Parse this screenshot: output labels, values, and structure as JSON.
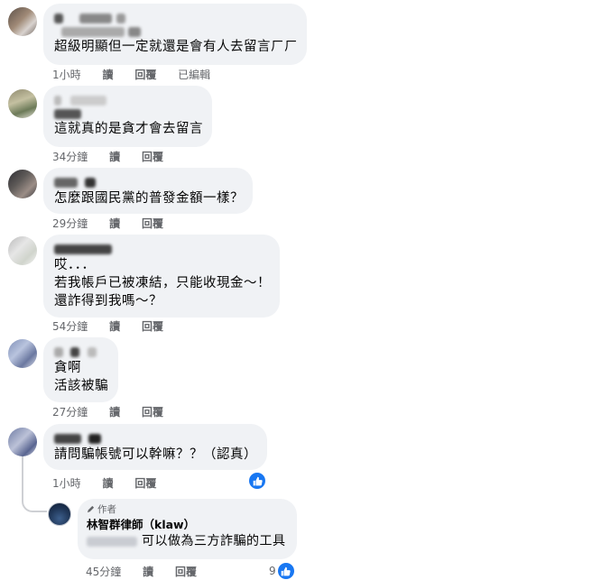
{
  "comments": [
    {
      "text": [
        "超級明顯但一定就還是會有人去留言ㄏㄏ"
      ],
      "time": "1小時",
      "reply": "讀",
      "reply2": "回覆",
      "edited": "已編輯"
    },
    {
      "text": [
        "這就真的是貪才會去留言"
      ],
      "time": "34分鐘",
      "reply": "讀",
      "reply2": "回覆"
    },
    {
      "text": [
        "怎麼跟國民黨的普發金額一樣？"
      ],
      "time": "29分鐘",
      "reply": "讀",
      "reply2": "回覆"
    },
    {
      "text": [
        "哎．．．",
        "若我帳戶已被凍結，只能收現金～！",
        "還詐得到我嗎～？"
      ],
      "time": "54分鐘",
      "reply": "讀",
      "reply2": "回覆"
    },
    {
      "text": [
        "貪啊",
        "活該被騙"
      ],
      "time": "27分鐘",
      "reply": "讀",
      "reply2": "回覆"
    },
    {
      "text": [
        "請問騙帳號可以幹嘛？？（認真）"
      ],
      "time": "1小時",
      "reply": "讀",
      "reply2": "回覆"
    }
  ],
  "author_reply": {
    "badge": "作者",
    "name": "林智群律師（klaw）",
    "text": "可以做為三方詐騙的工具",
    "time": "45分鐘",
    "reply": "讀",
    "reply2": "回覆",
    "likes": "9"
  },
  "colors": {
    "bubble": "#f0f2f5",
    "meta": "#65676b",
    "like": "#1877f2"
  }
}
